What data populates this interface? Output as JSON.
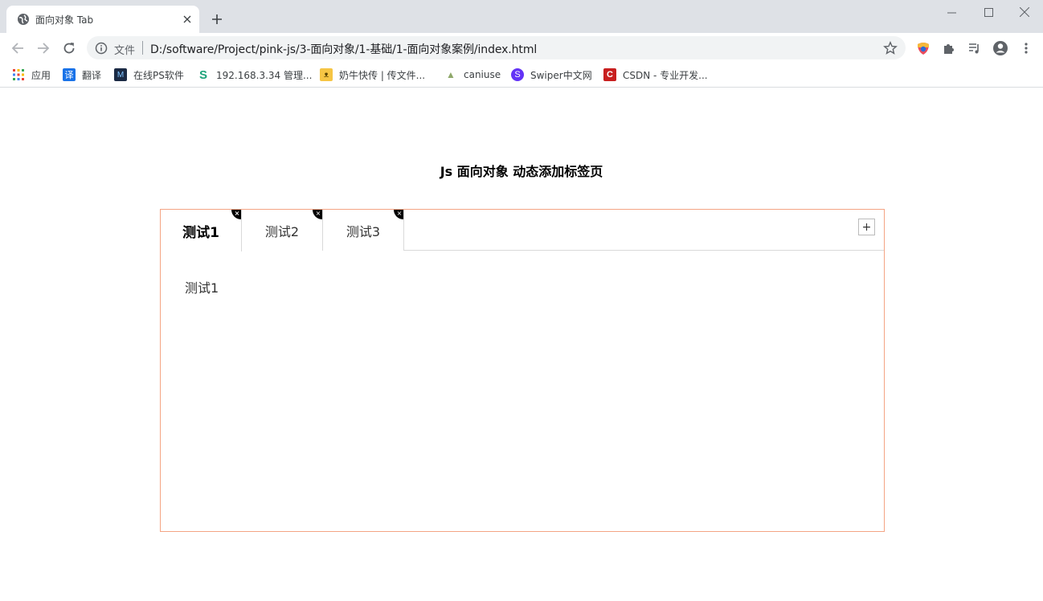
{
  "browser": {
    "tab": {
      "title": "面向对象 Tab",
      "close_glyph": "✕"
    },
    "new_tab_glyph": "+",
    "omnibox": {
      "file_label": "文件",
      "url": "D:/software/Project/pink-js/3-面向对象/1-基础/1-面向对象案例/index.html"
    },
    "bookmarks": [
      {
        "label": "应用",
        "icon": "apps-grid-icon"
      },
      {
        "label": "翻译",
        "icon": "translate-icon",
        "glyph": "译",
        "color": "#1a73e8"
      },
      {
        "label": "在线PS软件",
        "icon": "photoshop-icon",
        "glyph": "M",
        "color": "#1b2a44"
      },
      {
        "label": "192.168.3.34 管理...",
        "icon": "s-logo-icon",
        "glyph": "S",
        "color": "#1ea37a"
      },
      {
        "label": "奶牛快传 | 传文件...",
        "icon": "cow-icon",
        "glyph": "ᴥ",
        "color": "#f6c544"
      },
      {
        "label": "caniuse",
        "icon": "caniuse-icon",
        "glyph": "▲",
        "color": "#8fa86a"
      },
      {
        "label": "Swiper中文网",
        "icon": "swiper-icon",
        "glyph": "S",
        "color": "#6332f6"
      },
      {
        "label": "CSDN - 专业开发...",
        "icon": "csdn-icon",
        "glyph": "C",
        "color": "#c81f1f"
      }
    ]
  },
  "page": {
    "heading": "Js 面向对象 动态添加标签页",
    "tabs": [
      {
        "label": "测试1",
        "active": true,
        "close_glyph": "×"
      },
      {
        "label": "测试2",
        "active": false,
        "close_glyph": "×"
      },
      {
        "label": "测试3",
        "active": false,
        "close_glyph": "×"
      }
    ],
    "add_glyph": "+",
    "content": "测试1",
    "colors": {
      "box_border": "#f4a484",
      "divider": "#d9d9d9"
    }
  }
}
